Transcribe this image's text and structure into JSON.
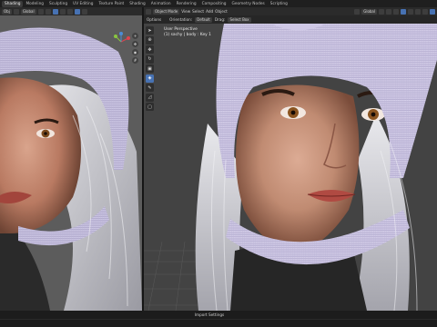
{
  "workspace_tabs": [
    "Shading",
    "Modeling",
    "Sculpting",
    "UV Editing",
    "Texture Paint",
    "Shading",
    "Animation",
    "Rendering",
    "Compositing",
    "Geometry Nodes",
    "Scripting"
  ],
  "active_tab_index": 0,
  "left_header": {
    "object_mode": "Obj",
    "orientation": "Global",
    "extra": "▾"
  },
  "right_header": {
    "mode": "Object Mode",
    "menus": [
      "View",
      "Select",
      "Add",
      "Object"
    ],
    "orientation": "Global"
  },
  "right_header2": {
    "options": "Options",
    "orientation_label": "Orientation:",
    "orientation_value": "Default",
    "drag_label": "Drag:",
    "drag_value": "Select Box"
  },
  "viewport_info": {
    "line1": "User Perspective",
    "line2": "(1) sachy | body : Key 1"
  },
  "bottom": {
    "import_settings": "Import Settings"
  },
  "colors": {
    "accent": "#4772b3",
    "helmet": "#c9c2e0",
    "skin": "#c48a72",
    "hair": "#d8d8dc"
  }
}
